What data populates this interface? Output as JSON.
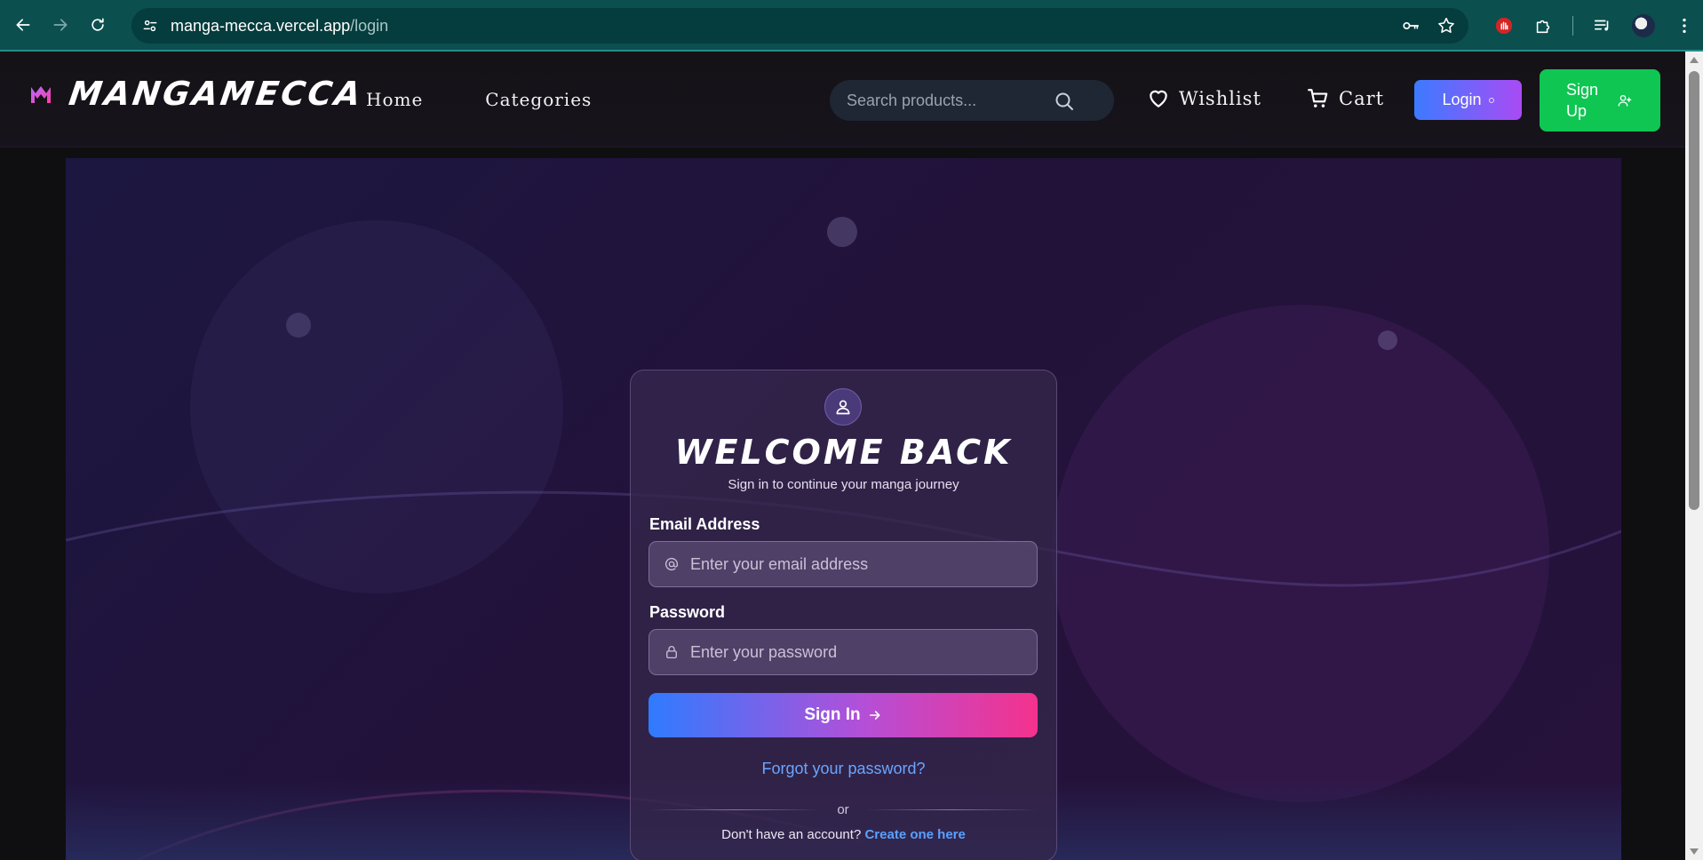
{
  "browser": {
    "url_host": "manga-mecca.vercel.app",
    "url_path": "/login",
    "back_icon": "arrow-left-icon",
    "forward_icon": "arrow-right-icon",
    "reload_icon": "reload-icon"
  },
  "header": {
    "logo_text": "MANGAMECCA",
    "nav": [
      "Home",
      "Categories"
    ],
    "search_placeholder": "Search products...",
    "wishlist_label": "Wishlist",
    "cart_label": "Cart",
    "login_label": "Login",
    "signup_label": "Sign Up"
  },
  "login_card": {
    "title": "WELCOME BACK",
    "subtitle": "Sign in to continue your manga journey",
    "email_label": "Email Address",
    "email_placeholder": "Enter your email address",
    "password_label": "Password",
    "password_placeholder": "Enter your password",
    "signin_label": "Sign In",
    "forgot_label": "Forgot your password?",
    "or_label": "or",
    "no_account_text": "Don't have an account?",
    "create_label": "Create one here"
  },
  "colors": {
    "chrome_bg": "#0b4f4f",
    "login_gradient_start": "#3c7bff",
    "login_gradient_end": "#a94bf4",
    "signup_bg": "#0fc653",
    "signin_gradient_end": "#f5328d",
    "link": "#6aa5ff"
  }
}
